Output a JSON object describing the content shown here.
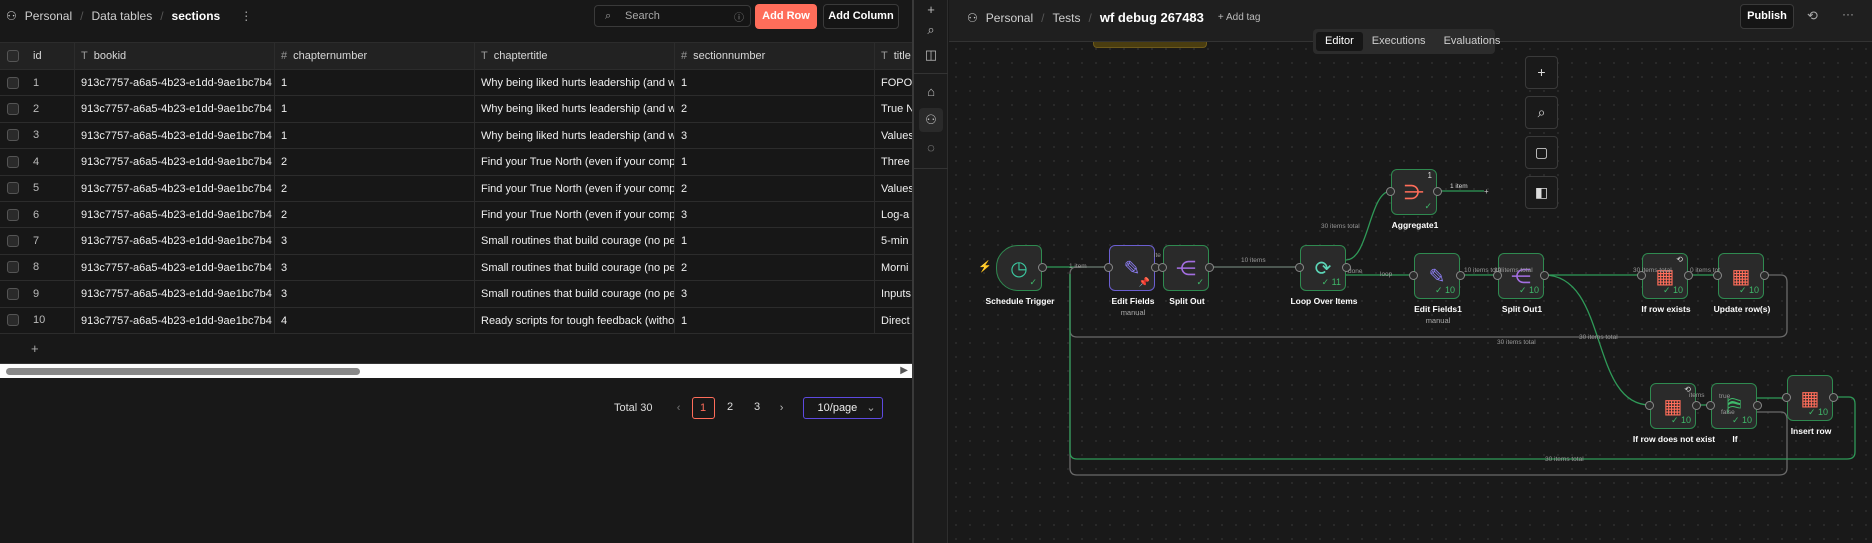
{
  "left": {
    "breadcrumb": [
      "Personal",
      "Data tables",
      "sections"
    ],
    "search_placeholder": "Search",
    "add_row": "Add Row",
    "add_column": "Add Column",
    "columns": [
      {
        "name": "id",
        "type": ""
      },
      {
        "name": "bookid",
        "type": "T"
      },
      {
        "name": "chapternumber",
        "type": "#"
      },
      {
        "name": "chaptertitle",
        "type": "T"
      },
      {
        "name": "sectionnumber",
        "type": "#"
      },
      {
        "name": "title",
        "type": "T"
      }
    ],
    "rows": [
      [
        "1",
        "913c7757-a6a5-4b23-e1dd-9ae1bc7b4",
        "1",
        "Why being liked hurts leadership (and w",
        "1",
        "FOPO"
      ],
      [
        "2",
        "913c7757-a6a5-4b23-e1dd-9ae1bc7b4",
        "1",
        "Why being liked hurts leadership (and w",
        "2",
        "True N"
      ],
      [
        "3",
        "913c7757-a6a5-4b23-e1dd-9ae1bc7b4",
        "1",
        "Why being liked hurts leadership (and w",
        "3",
        "Values"
      ],
      [
        "4",
        "913c7757-a6a5-4b23-e1dd-9ae1bc7b4",
        "2",
        "Find your True North (even if your comp",
        "1",
        "Three"
      ],
      [
        "5",
        "913c7757-a6a5-4b23-e1dd-9ae1bc7b4",
        "2",
        "Find your True North (even if your comp",
        "2",
        "Values"
      ],
      [
        "6",
        "913c7757-a6a5-4b23-e1dd-9ae1bc7b4",
        "2",
        "Find your True North (even if your comp",
        "3",
        "Log-a"
      ],
      [
        "7",
        "913c7757-a6a5-4b23-e1dd-9ae1bc7b4",
        "3",
        "Small routines that build courage (no pe",
        "1",
        "5-min"
      ],
      [
        "8",
        "913c7757-a6a5-4b23-e1dd-9ae1bc7b4",
        "3",
        "Small routines that build courage (no pe",
        "2",
        "Morni"
      ],
      [
        "9",
        "913c7757-a6a5-4b23-e1dd-9ae1bc7b4",
        "3",
        "Small routines that build courage (no pe",
        "3",
        "Inputs"
      ],
      [
        "10",
        "913c7757-a6a5-4b23-e1dd-9ae1bc7b4",
        "4",
        "Ready scripts for tough feedback (witho",
        "1",
        "Direct"
      ]
    ],
    "add_row_plus": "+",
    "pagination": {
      "total": "Total 30",
      "pages": [
        "1",
        "2",
        "3"
      ],
      "current": "1",
      "page_size": "10/page"
    }
  },
  "right": {
    "breadcrumb": [
      "Personal",
      "Tests",
      "wf debug 267483"
    ],
    "add_tag": "+ Add tag",
    "publish": "Publish",
    "tabs": [
      "Editor",
      "Executions",
      "Evaluations"
    ],
    "active_tab": "Editor",
    "nodes": [
      {
        "id": "trigger",
        "label": "Schedule Trigger",
        "icon": "clock-icon",
        "glyph": "◷",
        "color": "#3cc8a0",
        "status": "✓",
        "kind": "trig"
      },
      {
        "id": "edit",
        "label": "Edit Fields",
        "sub": "manual",
        "icon": "pencil-icon",
        "glyph": "✎",
        "color": "#8b7cf0",
        "status": "📌",
        "kind": "purple"
      },
      {
        "id": "split",
        "label": "Split Out",
        "icon": "split-icon",
        "glyph": "⋲",
        "color": "#a36ee0",
        "status": "✓"
      },
      {
        "id": "loop",
        "label": "Loop Over Items",
        "icon": "loop-icon",
        "glyph": "⟳",
        "color": "#5cd6b8",
        "status": "✓ 11"
      },
      {
        "id": "agg",
        "label": "Aggregate1",
        "icon": "aggregate-icon",
        "glyph": "⋺",
        "color": "#ff6d5a",
        "status": "✓",
        "badge": "1"
      },
      {
        "id": "edit1",
        "label": "Edit Fields1",
        "sub": "manual",
        "icon": "pencil-icon",
        "glyph": "✎",
        "color": "#8b7cf0",
        "status": "✓ 10"
      },
      {
        "id": "split1",
        "label": "Split Out1",
        "icon": "split-icon",
        "glyph": "⋲",
        "color": "#a36ee0",
        "status": "✓ 10"
      },
      {
        "id": "exists",
        "label": "If row exists",
        "icon": "table-icon",
        "glyph": "▦",
        "color": "#ff6d5a",
        "status": "✓ 10",
        "badge": "⟲"
      },
      {
        "id": "update",
        "label": "Update row(s)",
        "icon": "table-icon",
        "glyph": "▦",
        "color": "#ff6d5a",
        "status": "✓ 10"
      },
      {
        "id": "notexist",
        "label": "If row does not exist",
        "icon": "table-icon",
        "glyph": "▦",
        "color": "#ff6d5a",
        "status": "✓ 10",
        "badge": "⟲"
      },
      {
        "id": "if",
        "label": "If",
        "icon": "signpost-icon",
        "glyph": "⛿",
        "color": "#3fb96a",
        "status": "✓ 10"
      },
      {
        "id": "insert",
        "label": "Insert row",
        "icon": "table-icon",
        "glyph": "▦",
        "color": "#ff6d5a",
        "status": "✓ 10"
      }
    ],
    "edge_labels": [
      "1 item",
      "ite",
      "10 items",
      "30 items total",
      "1 item",
      "done",
      "loop",
      "10 items total",
      "10 items total",
      "30 items total",
      "0 items tot",
      "30 items total",
      "items",
      "true",
      "false",
      "30 items total",
      "30 items total"
    ],
    "colors": {
      "accent": "#ff6d5a",
      "success": "#3fb96a",
      "edge": "#2f9a58",
      "edge_gray": "#6a6a6a"
    }
  }
}
